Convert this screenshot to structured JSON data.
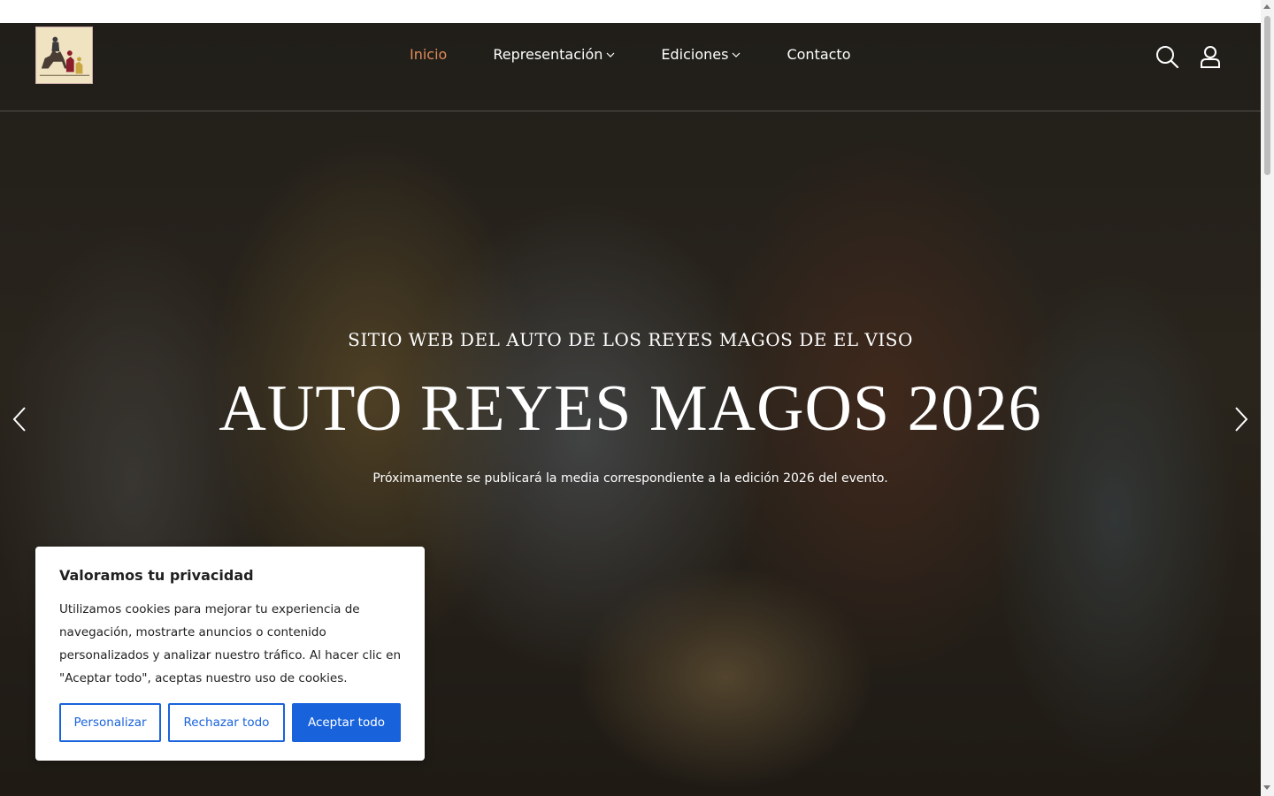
{
  "nav": {
    "items": [
      {
        "label": "Inicio",
        "active": true,
        "dropdown": false
      },
      {
        "label": "Representación",
        "active": false,
        "dropdown": true
      },
      {
        "label": "Ediciones",
        "active": false,
        "dropdown": true
      },
      {
        "label": "Contacto",
        "active": false,
        "dropdown": false
      }
    ],
    "active_color": "#e08a5a"
  },
  "header": {
    "logo": "camel-riders-logo",
    "icons": [
      "search-icon",
      "user-icon"
    ]
  },
  "hero": {
    "subtitle": "SITIO WEB DEL AUTO DE LOS REYES MAGOS DE EL VISO",
    "title": "AUTO REYES MAGOS 2026",
    "description": "Próximamente se publicará la media correspondiente a la edición 2026 del evento.",
    "prev_icon": "chevron-left-icon",
    "next_icon": "chevron-right-icon"
  },
  "cookie": {
    "title": "Valoramos tu privacidad",
    "text": "Utilizamos cookies para mejorar tu experiencia de navegación, mostrarte anuncios o contenido personalizados y analizar nuestro tráfico. Al hacer clic en \"Aceptar todo\", aceptas nuestro uso de cookies.",
    "customize_label": "Personalizar",
    "reject_label": "Rechazar todo",
    "accept_label": "Aceptar todo",
    "accent_color": "#1863dc"
  }
}
